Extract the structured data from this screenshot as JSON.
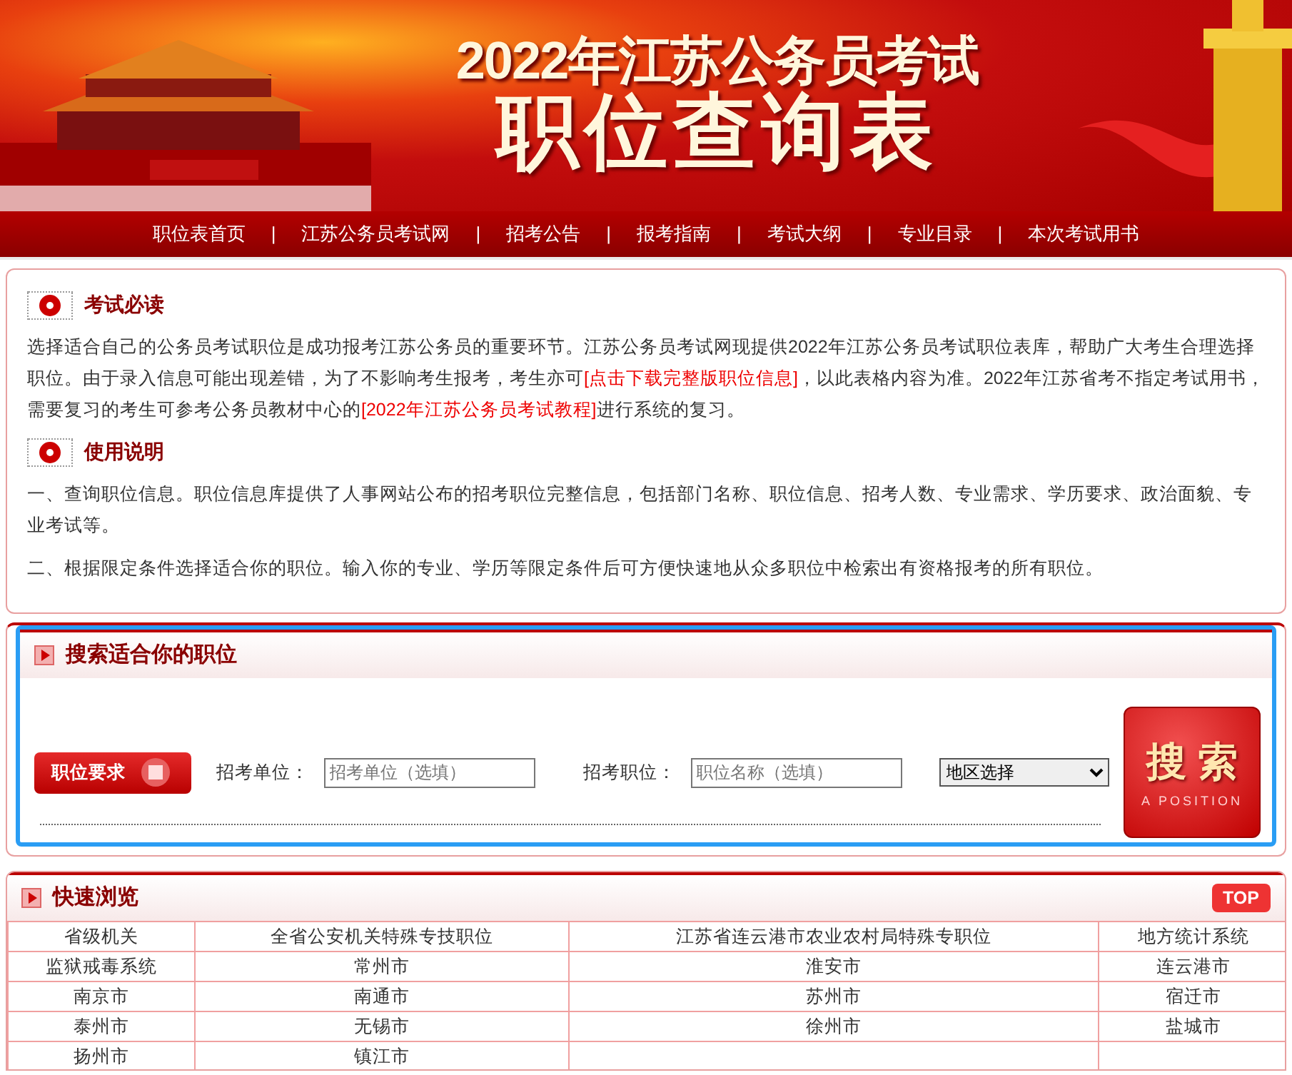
{
  "banner": {
    "title_line_1": "2022年江苏公务员考试",
    "title_line_2": "职位查询表"
  },
  "nav": {
    "items": [
      {
        "label": "职位表首页"
      },
      {
        "label": "江苏公务员考试网"
      },
      {
        "label": "招考公告"
      },
      {
        "label": "报考指南"
      },
      {
        "label": "考试大纲"
      },
      {
        "label": "专业目录"
      },
      {
        "label": "本次考试用书"
      }
    ],
    "separators": [
      "|",
      "|",
      "|",
      "|",
      "|",
      "|"
    ]
  },
  "intro": {
    "sections": [
      {
        "heading": "考试必读",
        "paragraphs": [
          [
            {
              "kind": "text",
              "text": "选择适合自己的公务员考试职位是成功报考江苏公务员的重要环节。江苏公务员考试网现提供2022年江苏公务员考试职位表库，帮助广大考生合理选择职位。由于录入信息可能出现差错，为了不影响考生报考，考生亦可"
            },
            {
              "kind": "link",
              "text": "[点击下载完整版职位信息]"
            },
            {
              "kind": "text",
              "text": "，以此表格内容为准。2022年江苏省考不指定考试用书，需要复习的考生可参考公务员教材中心的"
            },
            {
              "kind": "link",
              "text": "[2022年江苏公务员考试教程]"
            },
            {
              "kind": "text",
              "text": "进行系统的复习。"
            }
          ]
        ]
      },
      {
        "heading": "使用说明",
        "paragraphs": [
          [
            {
              "kind": "text",
              "text": "一、查询职位信息。职位信息库提供了人事网站公布的招考职位完整信息，包括部门名称、职位信息、招考人数、专业需求、学历要求、政治面貌、专业考试等。"
            }
          ],
          [
            {
              "kind": "text",
              "text": "二、根据限定条件选择适合你的职位。输入你的专业、学历等限定条件后可方便快速地从众多职位中检索出有资格报考的所有职位。"
            }
          ]
        ]
      }
    ]
  },
  "search": {
    "title": "搜索适合你的职位",
    "tag": "职位要求",
    "fields": [
      {
        "label": "招考单位：",
        "placeholder": "招考单位（选填）"
      },
      {
        "label": "招考职位：",
        "placeholder": "职位名称（选填）"
      }
    ],
    "region_select": {
      "value": "地区选择"
    },
    "button": {
      "label": "搜 索",
      "subtitle": "A POSITION"
    }
  },
  "quick_browse": {
    "title": "快速浏览",
    "top_button": "TOP",
    "rows": [
      [
        "省级机关",
        "全省公安机关特殊专技职位",
        "江苏省连云港市农业农村局特殊专职位",
        "地方统计系统"
      ],
      [
        "监狱戒毒系统",
        "常州市",
        "淮安市",
        "连云港市"
      ],
      [
        "南京市",
        "南通市",
        "苏州市",
        "宿迁市"
      ],
      [
        "泰州市",
        "无锡市",
        "徐州市",
        "盐城市"
      ],
      [
        "扬州市",
        "镇江市"
      ]
    ]
  }
}
